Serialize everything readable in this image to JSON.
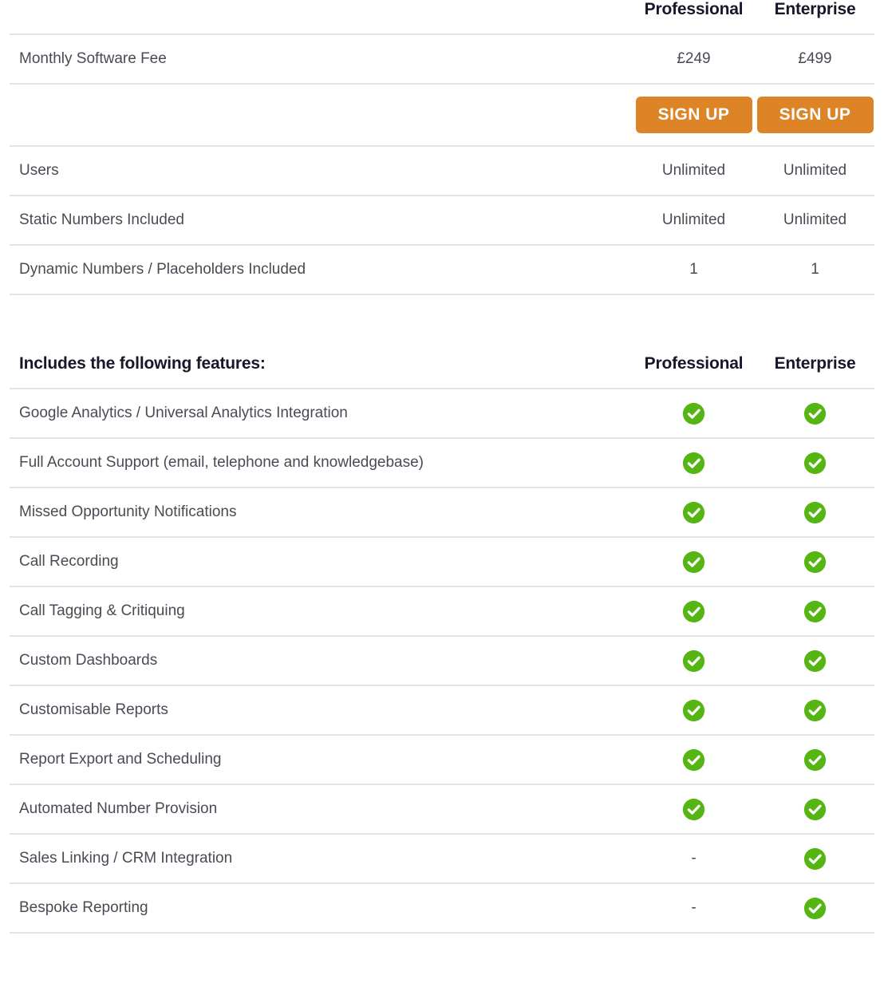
{
  "plans": {
    "professional": "Professional",
    "enterprise": "Enterprise"
  },
  "colors": {
    "signup_button": "#dd8526",
    "check_green": "#55b513",
    "row_divider": "#e2e2e2",
    "heading_text": "#17172b",
    "body_text": "#4a4a55"
  },
  "pricing_section": {
    "rows": [
      {
        "label": "Monthly Software Fee",
        "professional": "£249",
        "enterprise": "£499"
      },
      {
        "label": "Users",
        "professional": "Unlimited",
        "enterprise": "Unlimited"
      },
      {
        "label": "Static Numbers Included",
        "professional": "Unlimited",
        "enterprise": "Unlimited"
      },
      {
        "label": "Dynamic Numbers / Placeholders Included",
        "professional": "1",
        "enterprise": "1"
      }
    ],
    "signup": {
      "professional_label": "SIGN UP",
      "enterprise_label": "SIGN UP"
    }
  },
  "features_section": {
    "title": "Includes the following features:",
    "professional_header": "Professional",
    "enterprise_header": "Enterprise",
    "included_icon": "check-circle-icon",
    "excluded_mark": "-",
    "rows": [
      {
        "label": "Google Analytics / Universal Analytics Integration",
        "professional": "included",
        "enterprise": "included"
      },
      {
        "label": "Full Account Support (email, telephone and knowledgebase)",
        "professional": "included",
        "enterprise": "included"
      },
      {
        "label": "Missed Opportunity Notifications",
        "professional": "included",
        "enterprise": "included"
      },
      {
        "label": "Call Recording",
        "professional": "included",
        "enterprise": "included"
      },
      {
        "label": "Call Tagging & Critiquing",
        "professional": "included",
        "enterprise": "included"
      },
      {
        "label": "Custom Dashboards",
        "professional": "included",
        "enterprise": "included"
      },
      {
        "label": "Customisable Reports",
        "professional": "included",
        "enterprise": "included"
      },
      {
        "label": "Report Export and Scheduling",
        "professional": "included",
        "enterprise": "included"
      },
      {
        "label": "Automated Number Provision",
        "professional": "included",
        "enterprise": "included"
      },
      {
        "label": "Sales Linking / CRM Integration",
        "professional": "excluded",
        "enterprise": "included"
      },
      {
        "label": "Bespoke Reporting",
        "professional": "excluded",
        "enterprise": "included"
      }
    ]
  }
}
